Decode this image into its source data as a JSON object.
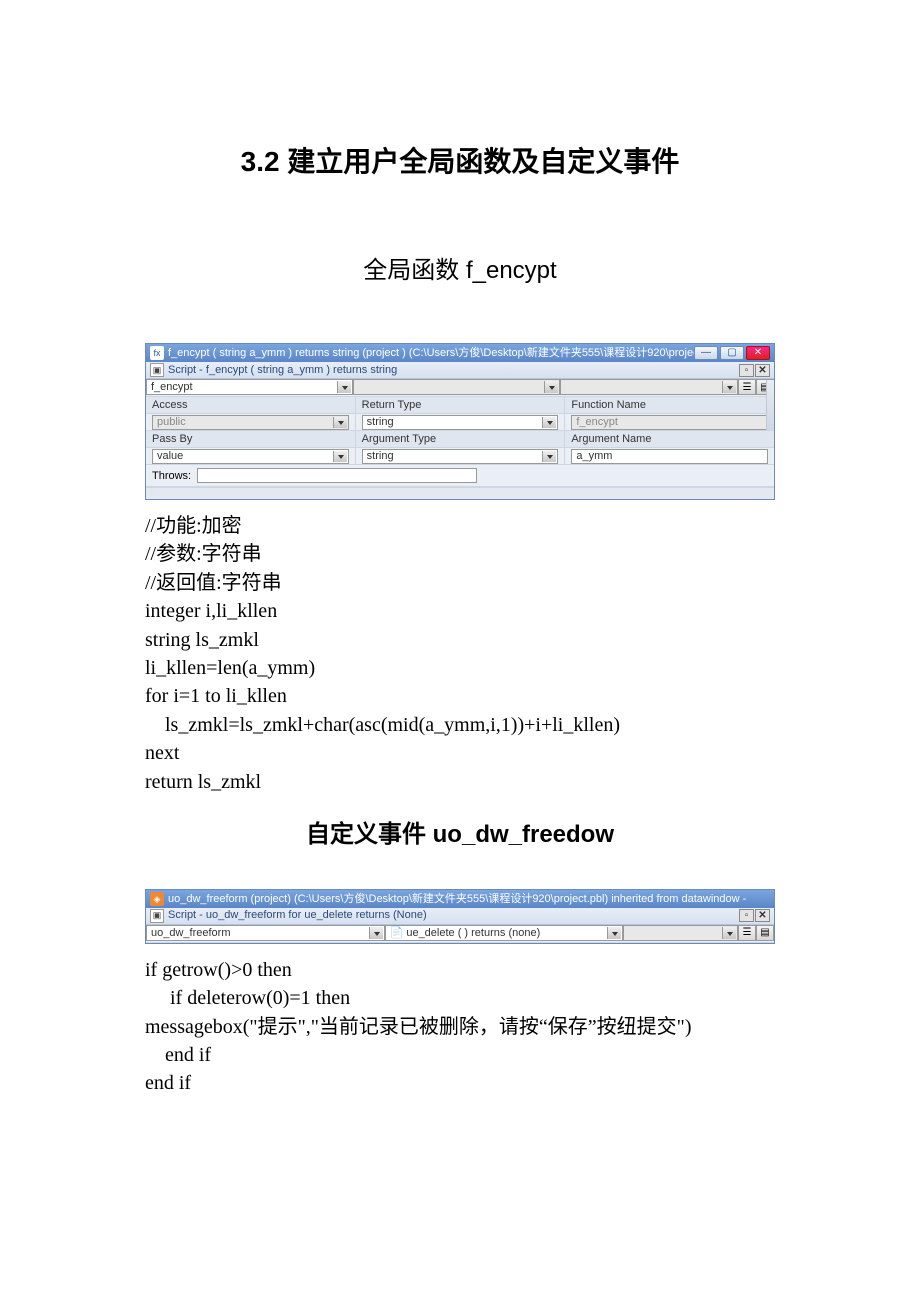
{
  "headings": {
    "main": "3.2 建立用户全局函数及自定义事件",
    "section1": "全局函数 f_encypt",
    "section2": "自定义事件 uo_dw_freedow"
  },
  "win1": {
    "title": "f_encypt ( string a_ymm )  returns string (project ) (C:\\Users\\方俊\\Desktop\\新建文件夹555\\课程设计920\\project.pbl) - Fu...",
    "subbar": "Script - f_encypt ( string a_ymm ) returns string",
    "dropdown1": "f_encypt",
    "labels": {
      "access": "Access",
      "return_type": "Return Type",
      "function_name": "Function Name",
      "pass_by": "Pass By",
      "argument_type": "Argument Type",
      "argument_name": "Argument Name",
      "throws": "Throws:"
    },
    "values": {
      "access": "public",
      "return_type": "string",
      "function_name": "f_encypt",
      "pass_by": "value",
      "argument_type": "string",
      "argument_name": "a_ymm"
    }
  },
  "code1": "//功能:加密\n//参数:字符串\n//返回值:字符串\ninteger i,li_kllen\nstring ls_zmkl\nli_kllen=len(a_ymm)\nfor i=1 to li_kllen\n    ls_zmkl=ls_zmkl+char(asc(mid(a_ymm,i,1))+i+li_kllen)\nnext\nreturn ls_zmkl",
  "win2": {
    "title": "uo_dw_freeform (project) (C:\\Users\\方俊\\Desktop\\新建文件夹555\\课程设计920\\project.pbl) inherited from datawindow -",
    "subbar": "Script - uo_dw_freeform for ue_delete returns (None)",
    "dd_left": "uo_dw_freeform",
    "dd_mid_icon": "📄",
    "dd_mid": "ue_delete ( ) returns (none)"
  },
  "code2": "if getrow()>0 then\n     if deleterow(0)=1 then\nmessagebox(\"提示\",\"当前记录已被删除，请按“保存”按纽提交\")\n    end if\nend if"
}
